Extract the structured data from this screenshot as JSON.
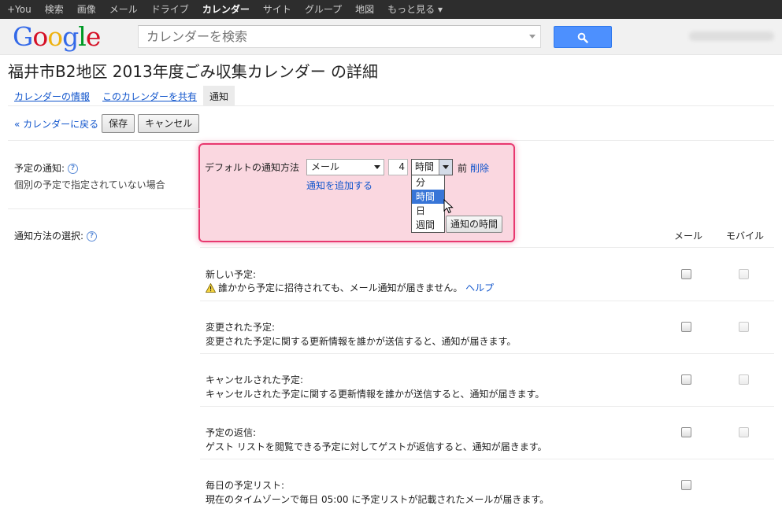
{
  "topbar": {
    "items": [
      "+You",
      "検索",
      "画像",
      "メール",
      "ドライブ",
      "カレンダー",
      "サイト",
      "グループ",
      "地図",
      "もっと見る ▾"
    ],
    "active_index": 5
  },
  "header": {
    "logo": {
      "g1": "G",
      "o1": "o",
      "o2": "o",
      "g2": "g",
      "l": "l",
      "e": "e"
    },
    "search_placeholder": "カレンダーを検索"
  },
  "page_title": "福井市B2地区 2013年度ごみ収集カレンダー の詳細",
  "tabs": [
    {
      "label": "カレンダーの情報"
    },
    {
      "label": "このカレンダーを共有"
    },
    {
      "label": "通知"
    }
  ],
  "actions": {
    "back": "« カレンダーに戻る",
    "save": "保存",
    "cancel": "キャンセル"
  },
  "event_notification": {
    "title": "予定の通知:",
    "subtitle": "個別の予定で指定されていない場合",
    "help": "?",
    "default_method_label": "デフォルトの通知方法",
    "method_value": "メール",
    "number_value": "4",
    "unit_value": "時間",
    "unit_options": [
      "分",
      "時間",
      "日",
      "週間"
    ],
    "unit_selected_index": 1,
    "before_label": "前",
    "delete_link": "削除",
    "add_link": "通知を追加する",
    "time_button": "通知の時間"
  },
  "method_selection": {
    "title": "通知方法の選択:",
    "help": "?",
    "col_email": "メール",
    "col_mobile": "モバイル"
  },
  "rows": [
    {
      "title": "新しい予定:",
      "desc": "誰かから予定に招待されても、メール通知が届きません。",
      "help_link": "ヘルプ",
      "warn": true
    },
    {
      "title": "変更された予定:",
      "desc": "変更された予定に関する更新情報を誰かが送信すると、通知が届きます。"
    },
    {
      "title": "キャンセルされた予定:",
      "desc": "キャンセルされた予定に関する更新情報を誰かが送信すると、通知が届きます。"
    },
    {
      "title": "予定の返信:",
      "desc": "ゲスト リストを閲覧できる予定に対してゲストが返信すると、通知が届きます。"
    },
    {
      "title": "毎日の予定リスト:",
      "desc": "現在のタイムゾーンで毎日 05:00 に予定リストが記載されたメールが届きます。"
    }
  ],
  "colors": {
    "highlight_border": "#e8386f",
    "link": "#1155cc",
    "search_button": "#4d90fe"
  },
  "icons": {
    "search": "magnifier-icon",
    "warning": "warning-triangle-icon",
    "cursor": "mouse-pointer-icon"
  }
}
